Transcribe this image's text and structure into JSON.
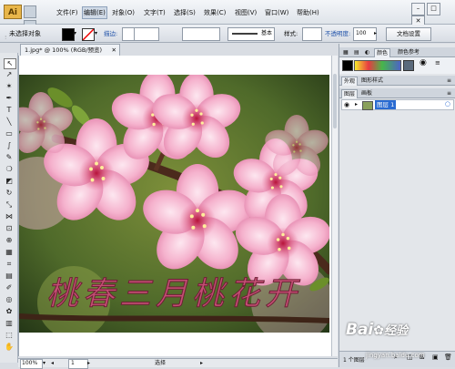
{
  "app": {
    "logo": "Ai"
  },
  "menu": {
    "items": [
      {
        "label": "文件(F)"
      },
      {
        "label": "编辑(E)"
      },
      {
        "label": "对象(O)"
      },
      {
        "label": "文字(T)"
      },
      {
        "label": "选择(S)"
      },
      {
        "label": "效果(C)"
      },
      {
        "label": "视图(V)"
      },
      {
        "label": "窗口(W)"
      },
      {
        "label": "帮助(H)"
      }
    ],
    "active_index": 1
  },
  "control": {
    "selection_status": "未选择对象",
    "stroke_label": "描边:",
    "stroke_style": "基本",
    "style_label": "样式:",
    "opacity_label": "不透明度:",
    "opacity_value": "100",
    "doc_setup_button": "文档设置"
  },
  "document": {
    "tab_title": "1.jpg* @ 100% (RGB/预览)",
    "artwork_text": "桃春三月桃花开"
  },
  "status": {
    "zoom": "100%",
    "artboard": "1",
    "tool": "选择"
  },
  "panels": {
    "top_tabs": [
      "颜色",
      "颜色参考"
    ],
    "appearance_tabs": [
      "外观",
      "图形样式"
    ],
    "layer_tabs": [
      "图层",
      "画板"
    ],
    "layer_name": "图层 1",
    "layer_count": "1 个图层"
  },
  "watermark": {
    "brand": "Bai",
    "site": "jingyan.baidu.com",
    "product": "经验"
  },
  "colors": {
    "menu_bg": "#eceff3",
    "accent": "#1d4fa8",
    "swatch_yellow": "#f7e92a",
    "swatch_red": "#e73a42",
    "swatch_green": "#46b74a",
    "swatch_blue": "#4d63c5",
    "blossom": "#f2a9c8",
    "background_green": "#5d7930"
  }
}
